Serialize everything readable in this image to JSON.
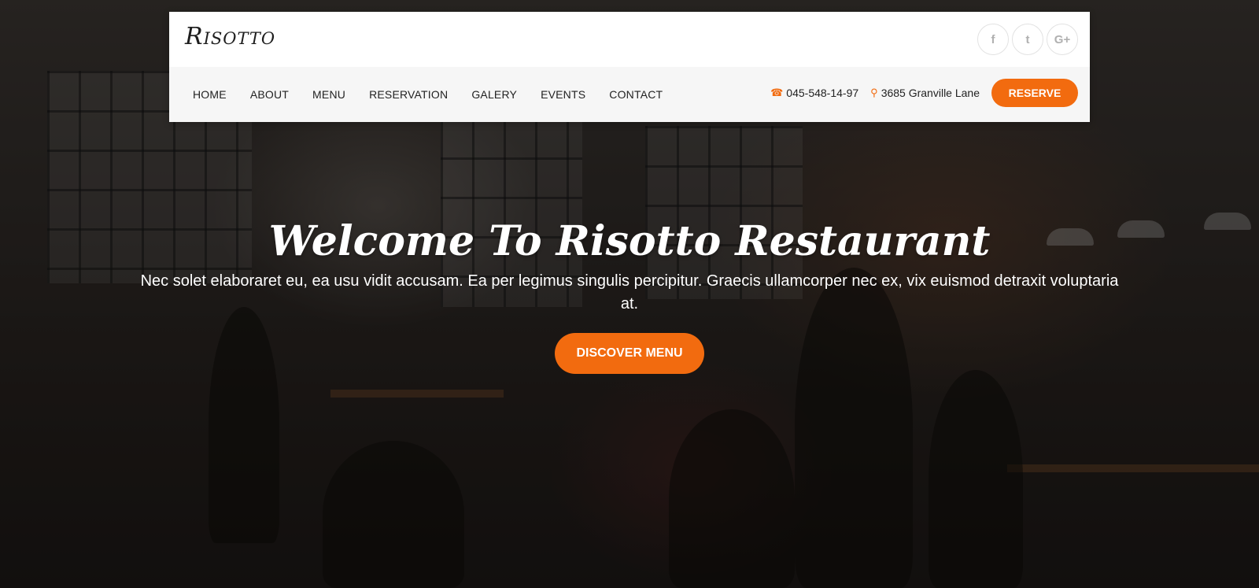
{
  "brand": {
    "logo_text": "Risotto"
  },
  "socials": [
    {
      "icon": "facebook-icon",
      "glyph": "f"
    },
    {
      "icon": "twitter-icon",
      "glyph": "t"
    },
    {
      "icon": "google-plus-icon",
      "glyph": "G+"
    }
  ],
  "nav": {
    "items": [
      "HOME",
      "ABOUT",
      "MENU",
      "RESERVATION",
      "GALERY",
      "EVENTS",
      "CONTACT"
    ]
  },
  "contact": {
    "phone_icon": "phone-icon",
    "phone": "045-548-14-97",
    "address_icon": "map-marker-icon",
    "address": "3685 Granville Lane"
  },
  "header": {
    "reserve_label": "RESERVE"
  },
  "hero": {
    "title": "Welcome To Risotto Restaurant",
    "text": "Nec solet elaboraret eu, ea usu vidit accusam. Ea per legimus singulis percipitur. Graecis ullamcorper nec ex, vix euismod detraxit voluptaria at.",
    "button_label": "DISCOVER MENU"
  },
  "colors": {
    "accent": "#f26b0f",
    "header_bg": "#ffffff",
    "nav_bg": "#f6f6f6"
  }
}
